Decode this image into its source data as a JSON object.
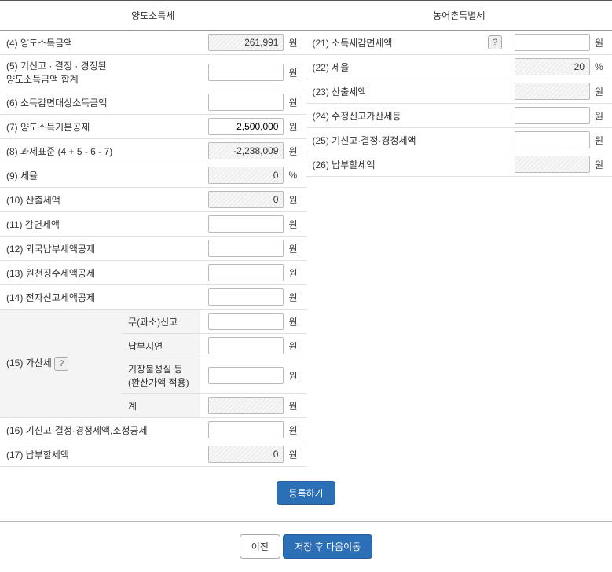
{
  "leftHeader": "양도소득세",
  "rightHeader": "농어촌특별세",
  "unit_won": "원",
  "unit_pct": "%",
  "help": "?",
  "left": {
    "r4": {
      "label": "(4) 양도소득금액",
      "val": "261,991"
    },
    "r5": {
      "label": "(5) 기신고 · 결정 · 경정된\n양도소득금액 합계",
      "val": ""
    },
    "r6": {
      "label": "(6) 소득감면대상소득금액",
      "val": ""
    },
    "r7": {
      "label": "(7) 양도소득기본공제",
      "val": "2,500,000"
    },
    "r8": {
      "label": "(8) 과세표준 (4 + 5 - 6 - 7)",
      "val": "-2,238,009"
    },
    "r9": {
      "label": "(9) 세율",
      "val": "0"
    },
    "r10": {
      "label": "(10) 산출세액",
      "val": "0"
    },
    "r11": {
      "label": "(11) 감면세액",
      "val": ""
    },
    "r12": {
      "label": "(12) 외국납부세액공제",
      "val": ""
    },
    "r13": {
      "label": "(13) 원천징수세액공제",
      "val": ""
    },
    "r14": {
      "label": "(14) 전자신고세액공제",
      "val": ""
    },
    "r15": {
      "label": "(15) 가산세",
      "a": {
        "lab": "무(과소)신고",
        "val": ""
      },
      "b": {
        "lab": "납부지연",
        "val": ""
      },
      "c": {
        "lab": "기장불성실 등\n(환산가액 적용)",
        "val": ""
      },
      "d": {
        "lab": "계",
        "val": ""
      }
    },
    "r16": {
      "label": "(16) 기신고·결정·경정세액,조정공제",
      "val": ""
    },
    "r17": {
      "label": "(17) 납부할세액",
      "val": "0"
    }
  },
  "right": {
    "r21": {
      "label": "(21) 소득세감면세액",
      "val": ""
    },
    "r22": {
      "label": "(22) 세율",
      "val": "20"
    },
    "r23": {
      "label": "(23) 산출세액",
      "val": ""
    },
    "r24": {
      "label": "(24) 수정신고가산세등",
      "val": ""
    },
    "r25": {
      "label": "(25) 기신고·결정·경정세액",
      "val": ""
    },
    "r26": {
      "label": "(26) 납부할세액",
      "val": ""
    }
  },
  "buttons": {
    "register": "등록하기",
    "prev": "이전",
    "saveNext": "저장 후 다음이동"
  }
}
